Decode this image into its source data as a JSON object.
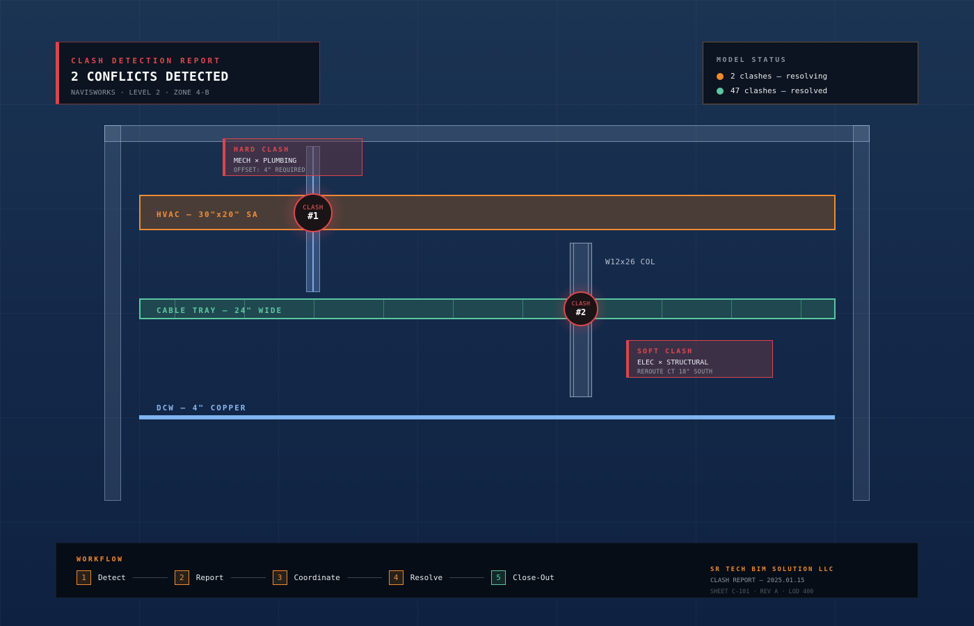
{
  "header": {
    "eyebrow": "CLASH DETECTION REPORT",
    "title": "2 CONFLICTS DETECTED",
    "subtitle": "NAVISWORKS · LEVEL 2 · ZONE 4-B"
  },
  "model_status": {
    "title": "MODEL STATUS",
    "items": [
      {
        "label": "2 clashes — resolving",
        "color": "#f08a2c"
      },
      {
        "label": "47 clashes — resolved",
        "color": "#5cc7a1"
      }
    ]
  },
  "systems": {
    "hvac": "HVAC — 30\"x20\" SA",
    "cable_tray": "CABLE TRAY — 24\" WIDE",
    "steel_column": "W12x26 COL",
    "dcw": "DCW — 4\" COPPER"
  },
  "clashes": [
    {
      "marker_word": "CLASH",
      "marker_num": "#1",
      "type": "HARD CLASH",
      "disciplines": "MECH × PLUMBING",
      "note": "OFFSET: 4\" REQUIRED"
    },
    {
      "marker_word": "CLASH",
      "marker_num": "#2",
      "type": "SOFT CLASH",
      "disciplines": "ELEC × STRUCTURAL",
      "note": "REROUTE CT 18\" SOUTH"
    }
  ],
  "workflow": {
    "title": "WORKFLOW",
    "steps": [
      {
        "num": "1",
        "label": "Detect"
      },
      {
        "num": "2",
        "label": "Report"
      },
      {
        "num": "3",
        "label": "Coordinate"
      },
      {
        "num": "4",
        "label": "Resolve"
      },
      {
        "num": "5",
        "label": "Close-Out"
      }
    ]
  },
  "footer": {
    "company": "SR TECH BIM SOLUTION LLC",
    "doc": "CLASH REPORT — 2025.01.15",
    "sheet": "SHEET C-101 · REV A · LOD 400"
  },
  "colors": {
    "clash": "#e0474c",
    "hvac": "#ee8b33",
    "cable_tray": "#5cc7a1",
    "dcw": "#7fb4ee"
  }
}
